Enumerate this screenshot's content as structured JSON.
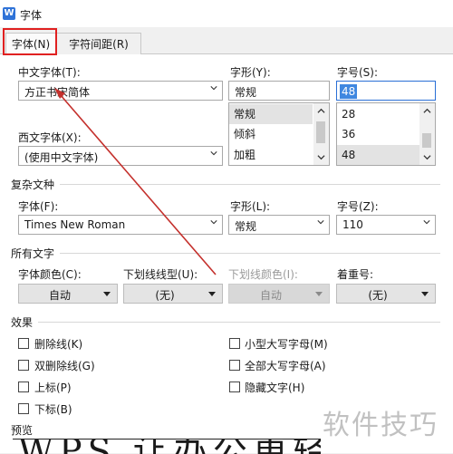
{
  "window": {
    "title": "字体"
  },
  "tabs": [
    {
      "label": "字体(N)",
      "active": true
    },
    {
      "label": "字符间距(R)",
      "active": false
    }
  ],
  "chinese_font": {
    "label": "中文字体(T):",
    "value": "方正书宋简体"
  },
  "style": {
    "label": "字形(Y):",
    "value": "常规",
    "options": [
      "常规",
      "倾斜",
      "加粗"
    ],
    "selected": "常规"
  },
  "size": {
    "label": "字号(S):",
    "value": "48",
    "options": [
      "28",
      "36",
      "48"
    ],
    "selected": "48"
  },
  "western_font": {
    "label": "西文字体(X):",
    "value": "(使用中文字体)"
  },
  "complex": {
    "section": "复杂文种",
    "font_label": "字体(F):",
    "font_value": "Times New Roman",
    "style_label": "字形(L):",
    "style_value": "常规",
    "size_label": "字号(Z):",
    "size_value": "110"
  },
  "all_text": {
    "section": "所有文字",
    "color_label": "字体颜色(C):",
    "color_value": "自动",
    "underline_label": "下划线线型(U):",
    "underline_value": "(无)",
    "underline_color_label": "下划线颜色(I):",
    "underline_color_value": "自动",
    "emphasis_label": "着重号:",
    "emphasis_value": "(无)"
  },
  "effects": {
    "section": "效果",
    "items_left": [
      "删除线(K)",
      "双删除线(G)",
      "上标(P)",
      "下标(B)"
    ],
    "items_right": [
      "小型大写字母(M)",
      "全部大写字母(A)",
      "隐藏文字(H)"
    ]
  },
  "preview": {
    "label": "预览",
    "sample": "WPS 让办公更轻松"
  },
  "watermark": "软件技巧",
  "colors": {
    "accent": "#2f73d8",
    "highlight": "#e02020",
    "arrow": "#c4302c"
  },
  "icons": {
    "dropdown": "chevron-down-icon",
    "app": "wps-icon"
  }
}
